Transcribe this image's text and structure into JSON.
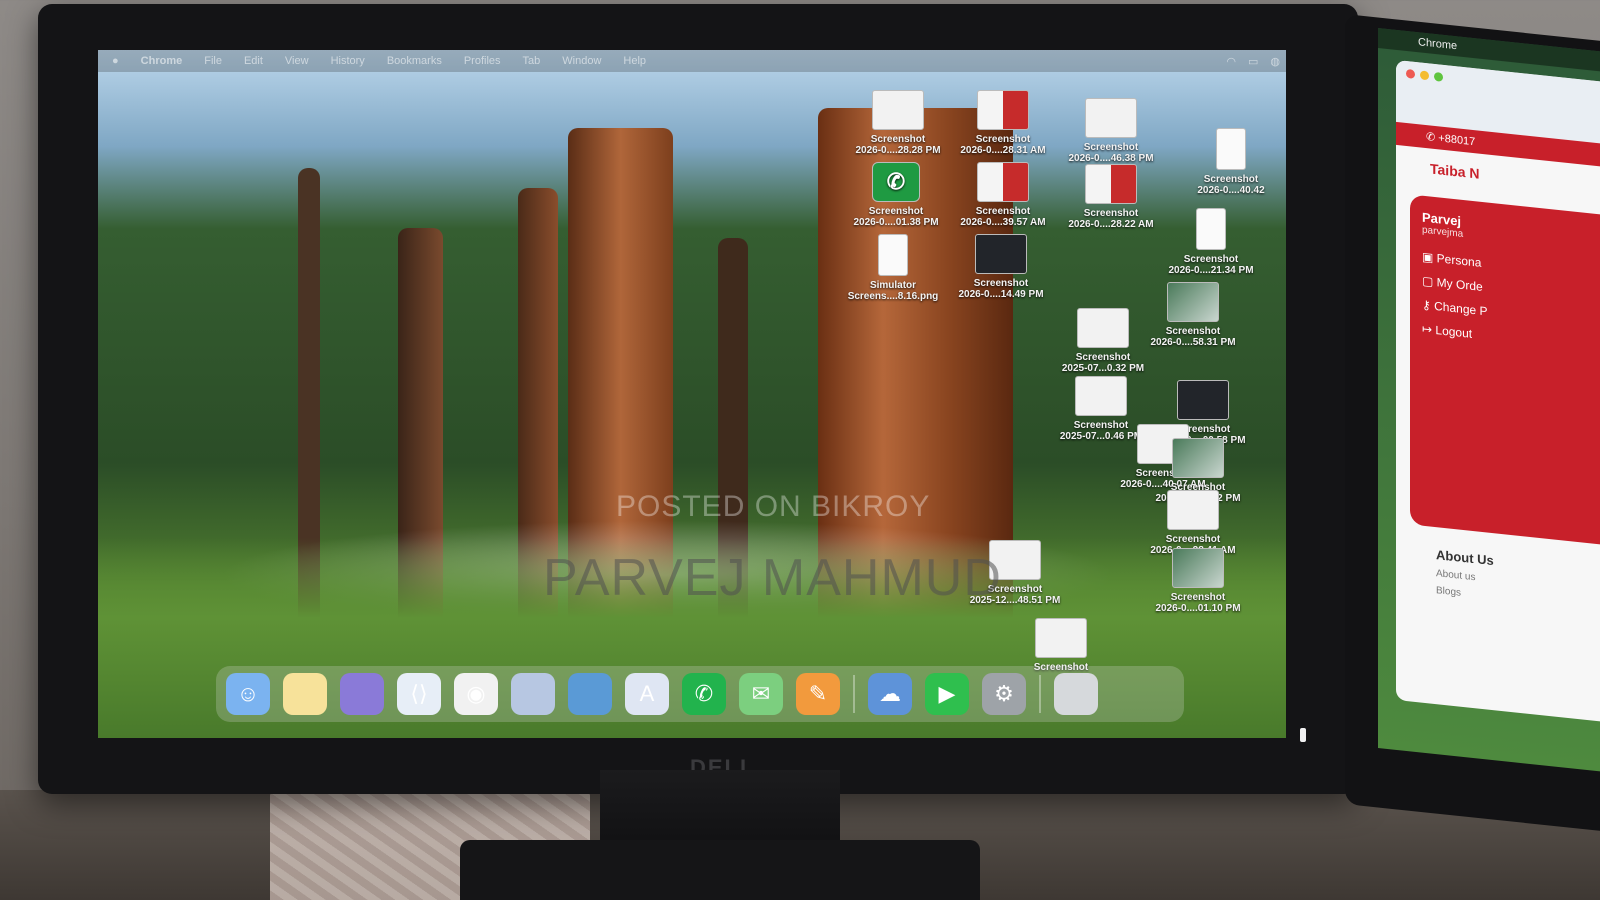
{
  "menubar": {
    "app": "Chrome",
    "items": [
      "File",
      "Edit",
      "View",
      "History",
      "Bookmarks",
      "Profiles",
      "Tab",
      "Window",
      "Help"
    ]
  },
  "desktop_icons": [
    {
      "title": "Screenshot",
      "subtitle": "2026-0....28.28 PM",
      "thumb": "doc"
    },
    {
      "title": "Screenshot",
      "subtitle": "2026-0....28.31 AM",
      "thumb": "red"
    },
    {
      "title": "Screenshot",
      "subtitle": "2026-0....46.38 PM",
      "thumb": "doc"
    },
    {
      "title": "Screenshot",
      "subtitle": "2026-0....40.42",
      "thumb": "phone"
    },
    {
      "title": "Screenshot",
      "subtitle": "2026-0....01.38 PM",
      "thumb": "whatsapp"
    },
    {
      "title": "Screenshot",
      "subtitle": "2026-0....39.57 AM",
      "thumb": "red"
    },
    {
      "title": "Screenshot",
      "subtitle": "2026-0....28.22 AM",
      "thumb": "red"
    },
    {
      "title": "Screenshot",
      "subtitle": "2026-0....21.34 PM",
      "thumb": "phone"
    },
    {
      "title": "Simulator",
      "subtitle": "Screens....8.16.png",
      "thumb": "phone"
    },
    {
      "title": "Screenshot",
      "subtitle": "2026-0....14.49 PM",
      "thumb": "dark"
    },
    {
      "title": "Screenshot",
      "subtitle": "2026-0....58.31 PM",
      "thumb": "photo"
    },
    {
      "title": "Screenshot",
      "subtitle": "2025-07...0.32 PM",
      "thumb": "doc"
    },
    {
      "title": "Screenshot",
      "subtitle": "2025-07...0.46 PM",
      "thumb": "doc"
    },
    {
      "title": "Screenshot",
      "subtitle": "2026-0....00.58 PM",
      "thumb": "dark"
    },
    {
      "title": "Screenshot",
      "subtitle": "2026-0....40.07 AM",
      "thumb": "doc"
    },
    {
      "title": "Screenshot",
      "subtitle": "2026-0....00.22 PM",
      "thumb": "photo"
    },
    {
      "title": "Screenshot",
      "subtitle": "2026-0....28.41 AM",
      "thumb": "doc"
    },
    {
      "title": "Screenshot",
      "subtitle": "2025-12....48.51 PM",
      "thumb": "doc"
    },
    {
      "title": "Screenshot",
      "subtitle": "2026-0....01.10 PM",
      "thumb": "photo"
    },
    {
      "title": "Screenshot",
      "subtitle": "",
      "thumb": "doc"
    }
  ],
  "watermark": {
    "line1": "POSTED ON BIKROY",
    "line2": "PARVEJ MAHMUD"
  },
  "monitor": {
    "brand": "DELL"
  },
  "dock": [
    {
      "name": "finder-icon",
      "glyph": "☺",
      "color": "#7bb3f0"
    },
    {
      "name": "notes-icon",
      "glyph": "",
      "color": "#f7e29a"
    },
    {
      "name": "launchpad-icon",
      "glyph": "",
      "color": "#8a7ad8"
    },
    {
      "name": "vscode-icon",
      "glyph": "⟨⟩",
      "color": "#e7eef7"
    },
    {
      "name": "chrome-icon",
      "glyph": "◉",
      "color": "#f1f1f1"
    },
    {
      "name": "preview-icon",
      "glyph": "",
      "color": "#b7c7e2"
    },
    {
      "name": "simulator-icon",
      "glyph": "",
      "color": "#5a9ad6"
    },
    {
      "name": "appstore-icon",
      "glyph": "A",
      "color": "#dfe6f3"
    },
    {
      "name": "whatsapp-icon",
      "glyph": "✆",
      "color": "#22b34d"
    },
    {
      "name": "messages-icon",
      "glyph": "✉",
      "color": "#7ccf7f"
    },
    {
      "name": "pages-icon",
      "glyph": "✎",
      "color": "#f29a3d"
    },
    {
      "name": "weather-icon",
      "glyph": "☁",
      "color": "#5e93d9"
    },
    {
      "name": "facetime-icon",
      "glyph": "▶",
      "color": "#2fbf4e"
    },
    {
      "name": "settings-icon",
      "glyph": "⚙",
      "color": "#9ea3a8"
    },
    {
      "name": "trash-icon",
      "glyph": "",
      "color": "#d6d9dc"
    }
  ],
  "second_monitor": {
    "menubar_app": "Chrome",
    "phone": "+88017",
    "logo": "Taiba N",
    "profile_name": "Parvej",
    "profile_email": "parvejma",
    "menu": [
      "Persona",
      "My Orde",
      "Change P",
      "Logout"
    ],
    "about_title": "About Us",
    "about_links": [
      "About us",
      "Blogs"
    ]
  }
}
